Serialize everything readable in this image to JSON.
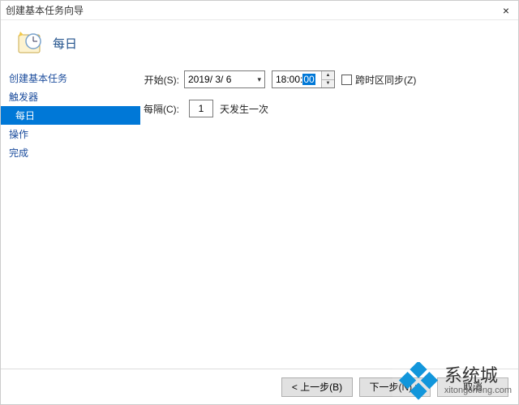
{
  "window": {
    "title": "创建基本任务向导"
  },
  "header": {
    "title": "每日"
  },
  "sidebar": {
    "items": [
      {
        "label": "创建基本任务"
      },
      {
        "label": "触发器"
      },
      {
        "label": "每日",
        "selected": true
      },
      {
        "label": "操作"
      },
      {
        "label": "完成"
      }
    ]
  },
  "form": {
    "start_label": "开始(S):",
    "date_value": "2019/ 3/ 6",
    "time_prefix": "18:00:",
    "time_selected": "00",
    "sync_tz_label": "跨时区同步(Z)",
    "interval_label": "每隔(C):",
    "interval_value": "1",
    "interval_suffix": "天发生一次"
  },
  "footer": {
    "back": "< 上一步(B)",
    "next": "下一步(N) >",
    "cancel": "取消"
  },
  "watermark": {
    "main": "系统城",
    "sub": "xitongcheng.com"
  }
}
